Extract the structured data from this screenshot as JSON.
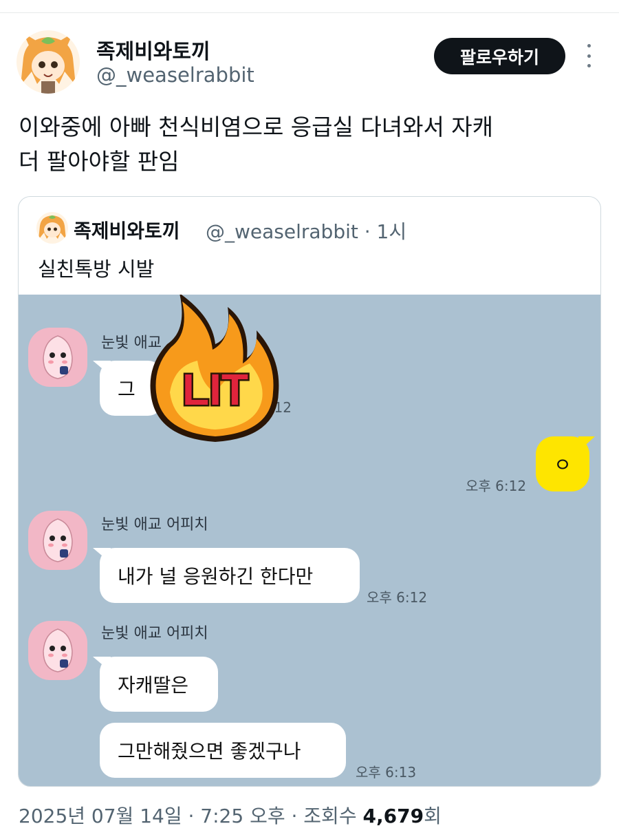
{
  "tweet": {
    "display_name": "족제비와토끼",
    "handle": "@_weaselrabbit",
    "follow_label": "팔로우하기",
    "text_line1": "이와중에 아빠 천식비염으로 응급실 다녀와서 자캐",
    "text_line2": "더 팔아야할 판임"
  },
  "quote": {
    "display_name": "족제비와토끼",
    "handle_time": "@_weaselrabbit · 1시",
    "text": "실친톡방 시발",
    "sticker_text": "LIT",
    "messages": [
      {
        "sender": "눈빛 애교",
        "text": "그",
        "time": "6:12"
      },
      {
        "mine": true,
        "text": "ㅇ",
        "time": "오후 6:12"
      },
      {
        "sender": "눈빛 애교 어피치",
        "text": "내가 널 응원하긴 한다만",
        "time": "오후 6:12"
      },
      {
        "sender": "눈빛 애교 어피치",
        "text": "자캐딸은"
      },
      {
        "text": "그만해줬으면 좋겠구나",
        "time": "오후 6:13"
      }
    ]
  },
  "meta": {
    "date_time": "2025년 07월 14일 · 7:25 오후 · 조회수 ",
    "views": "4,679",
    "views_suffix": "회"
  },
  "colors": {
    "chat_bg": "#abc1d1",
    "my_bubble": "#fee500",
    "follow_btn": "#0f1419",
    "avatar_pink": "#f2b7c6"
  }
}
